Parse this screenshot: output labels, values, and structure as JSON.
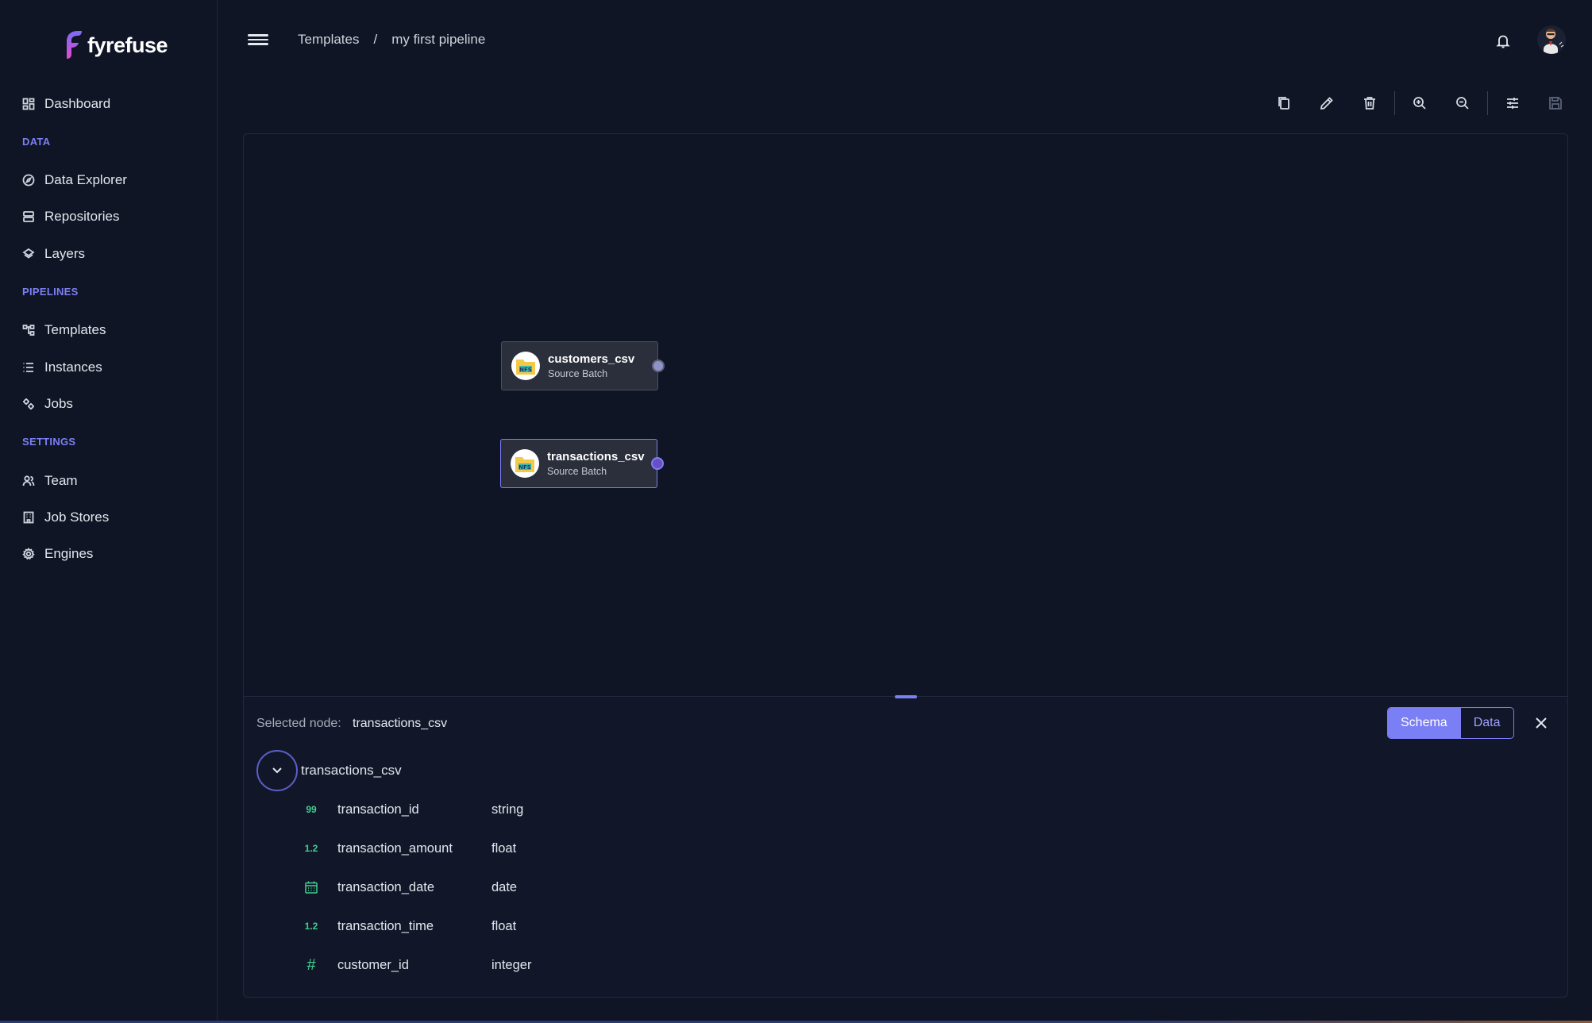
{
  "brand": {
    "name": "fyrefuse"
  },
  "sidebar": {
    "dashboard": "Dashboard",
    "sections": [
      {
        "title": "DATA",
        "items": [
          "Data Explorer",
          "Repositories",
          "Layers"
        ]
      },
      {
        "title": "PIPELINES",
        "items": [
          "Templates",
          "Instances",
          "Jobs"
        ]
      },
      {
        "title": "SETTINGS",
        "items": [
          "Team",
          "Job Stores",
          "Engines"
        ]
      }
    ]
  },
  "header": {
    "breadcrumb": [
      "Templates",
      "my first pipeline"
    ],
    "separator": "/"
  },
  "toolbar": {
    "tools": [
      "copy-icon",
      "edit-icon",
      "delete-icon",
      "zoom-in-icon",
      "zoom-out-icon",
      "settings-sliders-icon",
      "save-icon"
    ]
  },
  "nodes": [
    {
      "title": "customers_csv",
      "subtitle": "Source Batch",
      "badge": "NFS",
      "selected": false
    },
    {
      "title": "transactions_csv",
      "subtitle": "Source Batch",
      "badge": "NFS",
      "selected": true
    }
  ],
  "panel": {
    "selected_label": "Selected node:",
    "selected_value": "transactions_csv",
    "tabs": [
      "Schema",
      "Data"
    ],
    "active_tab": "Schema",
    "tree_title": "transactions_csv",
    "fields": [
      {
        "icon": "99",
        "name": "transaction_id",
        "type": "string"
      },
      {
        "icon": "1.2",
        "name": "transaction_amount",
        "type": "float"
      },
      {
        "icon": "calendar-icon",
        "name": "transaction_date",
        "type": "date"
      },
      {
        "icon": "1.2",
        "name": "transaction_time",
        "type": "float"
      },
      {
        "icon": "#",
        "name": "customer_id",
        "type": "integer"
      }
    ]
  },
  "colors": {
    "accent": "#7b7ff5",
    "background": "#0f1524",
    "type_icon": "#3ecf8e"
  }
}
